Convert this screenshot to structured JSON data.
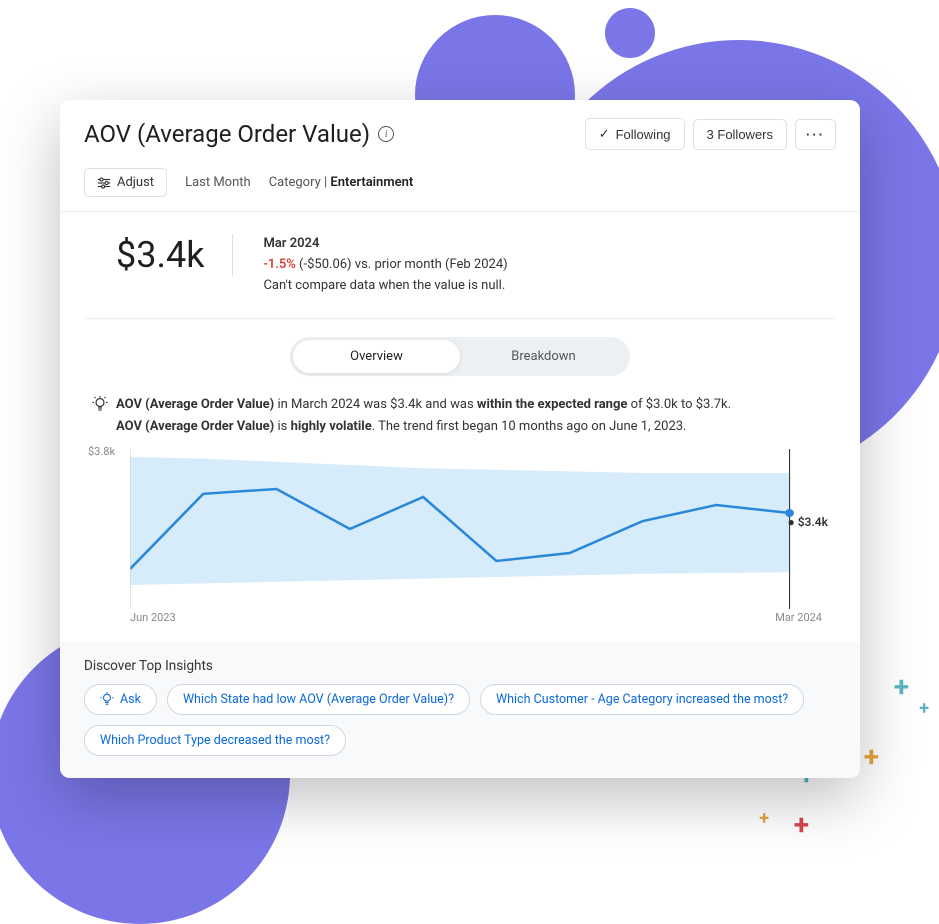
{
  "header": {
    "title": "AOV (Average Order Value)",
    "following_label": "Following",
    "followers_label": "3 Followers"
  },
  "toolbar": {
    "adjust_label": "Adjust",
    "period": "Last Month",
    "category_prefix": "Category | ",
    "category_value": "Entertainment"
  },
  "summary": {
    "big_value": "$3.4k",
    "month": "Mar 2024",
    "delta_pct": "-1.5%",
    "delta_detail": " (-$50.06) vs. prior month (Feb 2024)",
    "null_note": "Can't compare data when the value is null."
  },
  "toggle": {
    "overview": "Overview",
    "breakdown": "Breakdown"
  },
  "insights": {
    "line1_a": "AOV (Average Order Value)",
    "line1_b": " in March 2024 was $3.4k and was ",
    "line1_c": "within the expected range",
    "line1_d": " of $3.0k to $3.7k.",
    "line2_a": "AOV (Average Order Value)",
    "line2_b": " is ",
    "line2_c": "highly volatile",
    "line2_d": ". The trend first began 10 months ago on June 1, 2023."
  },
  "chart_data": {
    "type": "line",
    "title": "",
    "xlabel": "",
    "ylabel": "",
    "ylim": [
      2800,
      3800
    ],
    "y_tick_label": "$3.8k",
    "x_start_label": "Jun 2023",
    "x_end_label": "Mar 2024",
    "end_value_label": "$3.4k",
    "expected_range": [
      3000,
      3700
    ],
    "x": [
      "Jun 2023",
      "Jul 2023",
      "Aug 2023",
      "Sep 2023",
      "Oct 2023",
      "Nov 2023",
      "Dec 2023",
      "Jan 2024",
      "Feb 2024",
      "Mar 2024"
    ],
    "values": [
      3050,
      3520,
      3550,
      3300,
      3500,
      3100,
      3150,
      3350,
      3450,
      3400
    ],
    "band_upper": [
      3750,
      3740,
      3720,
      3700,
      3680,
      3670,
      3660,
      3650,
      3650,
      3650
    ],
    "band_lower": [
      2950,
      2960,
      2970,
      2980,
      2990,
      3000,
      3010,
      3020,
      3025,
      3030
    ]
  },
  "discover": {
    "title": "Discover Top Insights",
    "ask_label": "Ask",
    "chips": [
      "Which State had low AOV (Average Order Value)?",
      "Which Customer - Age Category increased the most?",
      "Which Product Type decreased the most?"
    ]
  }
}
